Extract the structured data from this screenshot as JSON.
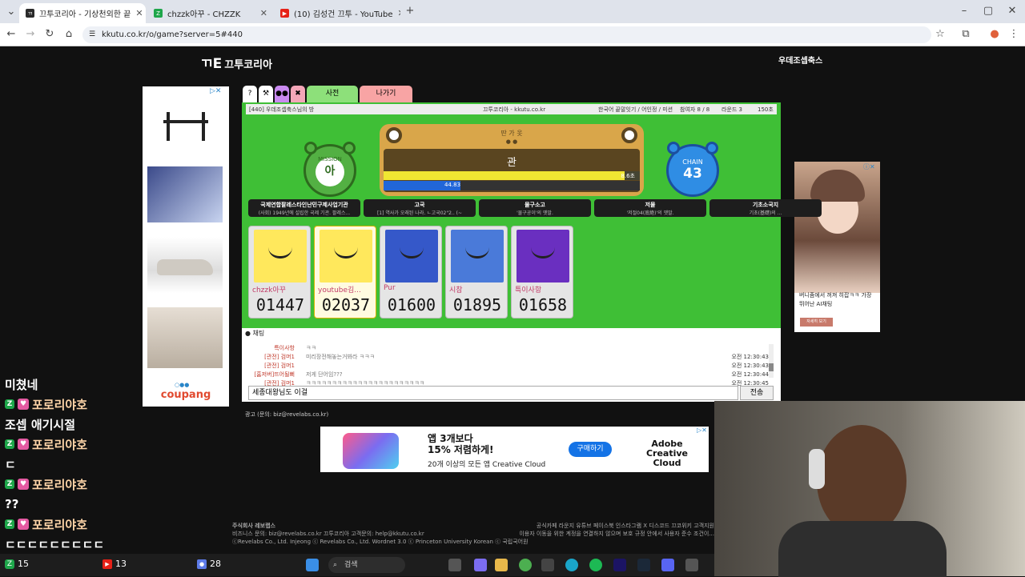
{
  "browser": {
    "tabs": [
      {
        "label": "끄투코리아 - 기상천외한 끝",
        "active": true,
        "color": "#2a2a2a"
      },
      {
        "label": "chzzk아꾸 - CHZZK",
        "active": false,
        "color": "#1ea64a"
      },
      {
        "label": "(10) 김성건 끄투 - YouTube",
        "active": false,
        "color": "#e62117"
      }
    ],
    "url": "kkutu.co.kr/o/game?server=5#440"
  },
  "site": {
    "logo": "끄투코리아",
    "username": "우데조셉축스"
  },
  "game_buttons": {
    "help": "?",
    "settings": "⚒",
    "users": "👥",
    "kick": "🚫",
    "spectate": "사전",
    "exit": "나가기"
  },
  "infobar": {
    "room": "[440] 우데조셉축스님의 방",
    "site": "끄투코리아 - kkutu.co.kr",
    "mode": "한국어 끝말잇기 / 어인정 / 미션",
    "players": "참여자 8 / 8",
    "round": "라운드 3",
    "time": "150초"
  },
  "board": {
    "hint": "딴 가 옷",
    "word": "관",
    "turn_time": "8.6초",
    "turn_fraction": 0.94,
    "round_time": "44.83",
    "round_fraction": 0.3,
    "mission_label": "MISSION",
    "mission_char": "아",
    "chain_label": "CHAIN",
    "chain_count": "43"
  },
  "history": [
    {
      "word": "국제연합팔레스타인난민구제사업기관",
      "meaning": "(사회) 1949년에 설립한 국제 기관. 팔레스..."
    },
    {
      "word": "고국",
      "meaning": "[1] 역사가 오래된 나라. ㄴ고국02\"2.. (~"
    },
    {
      "word": "물구소고",
      "meaning": "'물구공이'의 옛말."
    },
    {
      "word": "저물",
      "meaning": "'저절04(底絶)'의 옛말."
    },
    {
      "word": "기초소국지",
      "meaning": "기초(基礎)의 ..."
    }
  ],
  "players": [
    {
      "name": "chzzk아꾸",
      "score": "01447",
      "color": "#ffe85c",
      "active": false
    },
    {
      "name": "youtube김...",
      "score": "02037",
      "color": "#ffe85c",
      "active": true
    },
    {
      "name": "Pur",
      "score": "01600",
      "color": "#3558c9",
      "active": false
    },
    {
      "name": "시참",
      "score": "01895",
      "color": "#4a7ad9",
      "active": false
    },
    {
      "name": "특이사항",
      "score": "01658",
      "color": "#6a2fc0",
      "active": false
    }
  ],
  "chat": {
    "header": "채팅",
    "messages": [
      {
        "name": "특이사항",
        "msg": "ㅋㅋ",
        "time": ""
      },
      {
        "name": "[관전] 검머1",
        "msg": "미리장전해놓는거봐라 ㅋㅋㅋ",
        "time": "오전 12:30:43"
      },
      {
        "name": "[관전] 검머1",
        "msg": "",
        "time": "오전 12:30:43"
      },
      {
        "name": "[홈저버]뜨어될뻐",
        "msg": "저게 단어임???",
        "time": "오전 12:30:44"
      },
      {
        "name": "[관전] 검머1",
        "msg": "ㅋㅋㅋㅋㅋㅋㅋㅋㅋㅋㅋㅋㅋㅋㅋㅋㅋㅋㅋㅋㅋㅋㅋ",
        "time": "오전 12:30:45"
      }
    ],
    "input_value": "세종대왕님도 이걸",
    "send": "전송"
  },
  "ad_note": "광고 (문의: biz@revelabs.co.kr)",
  "left_ad": {
    "brand": "coupang"
  },
  "right_ad": {
    "text": "버니좀에서 꺼져 히잡ㅋㅋ 가장 뛰어난 AI채팅",
    "button": "자세히 보기"
  },
  "banner_ad": {
    "headline": "앱 3개보다\n15% 저렴하게!",
    "sub": "20개 이상의 모든 앱 Creative Cloud",
    "cta": "구매하기",
    "brand": "Adobe\nCreative Cloud"
  },
  "footer": {
    "company": "주식회사 레보랩스",
    "contact": "비즈니스 문의: biz@revelabs.co.kr  끄투코리아 고객문의: help@kkutu.co.kr",
    "copyright": "ⓒRevelabs Co., Ltd.  Injeong ⓒ Revelabs Co., Ltd.  Wordnet 3.0 ⓒ Princeton University  Korean ⓒ 국립국어원",
    "links": "공식카페 라운지 유튜브 페이스북 인스타그램 X 디스코드 끄코위키 고객지원",
    "notice": "이용자 이동을 위한 계정을 연결하지 않으며 보호 규정 안에서 사용자 준수 조건이..."
  },
  "stream_chat": [
    {
      "type": "text",
      "text": "미쳤네"
    },
    {
      "type": "name",
      "text": "포로리야호"
    },
    {
      "type": "text",
      "text": "조셉 애기시절"
    },
    {
      "type": "name",
      "text": "포로리야호"
    },
    {
      "type": "text",
      "text": "ㄷ"
    },
    {
      "type": "name",
      "text": "포로리야호"
    },
    {
      "type": "text",
      "text": "??"
    },
    {
      "type": "name",
      "text": "포로리야호"
    },
    {
      "type": "text",
      "text": "ㄷㄷㄷㄷㄷㄷㄷㄷㄷ"
    }
  ],
  "taskbar": {
    "chzzk_count": "15",
    "youtube_count": "13",
    "other_count": "28",
    "search": "검색"
  }
}
